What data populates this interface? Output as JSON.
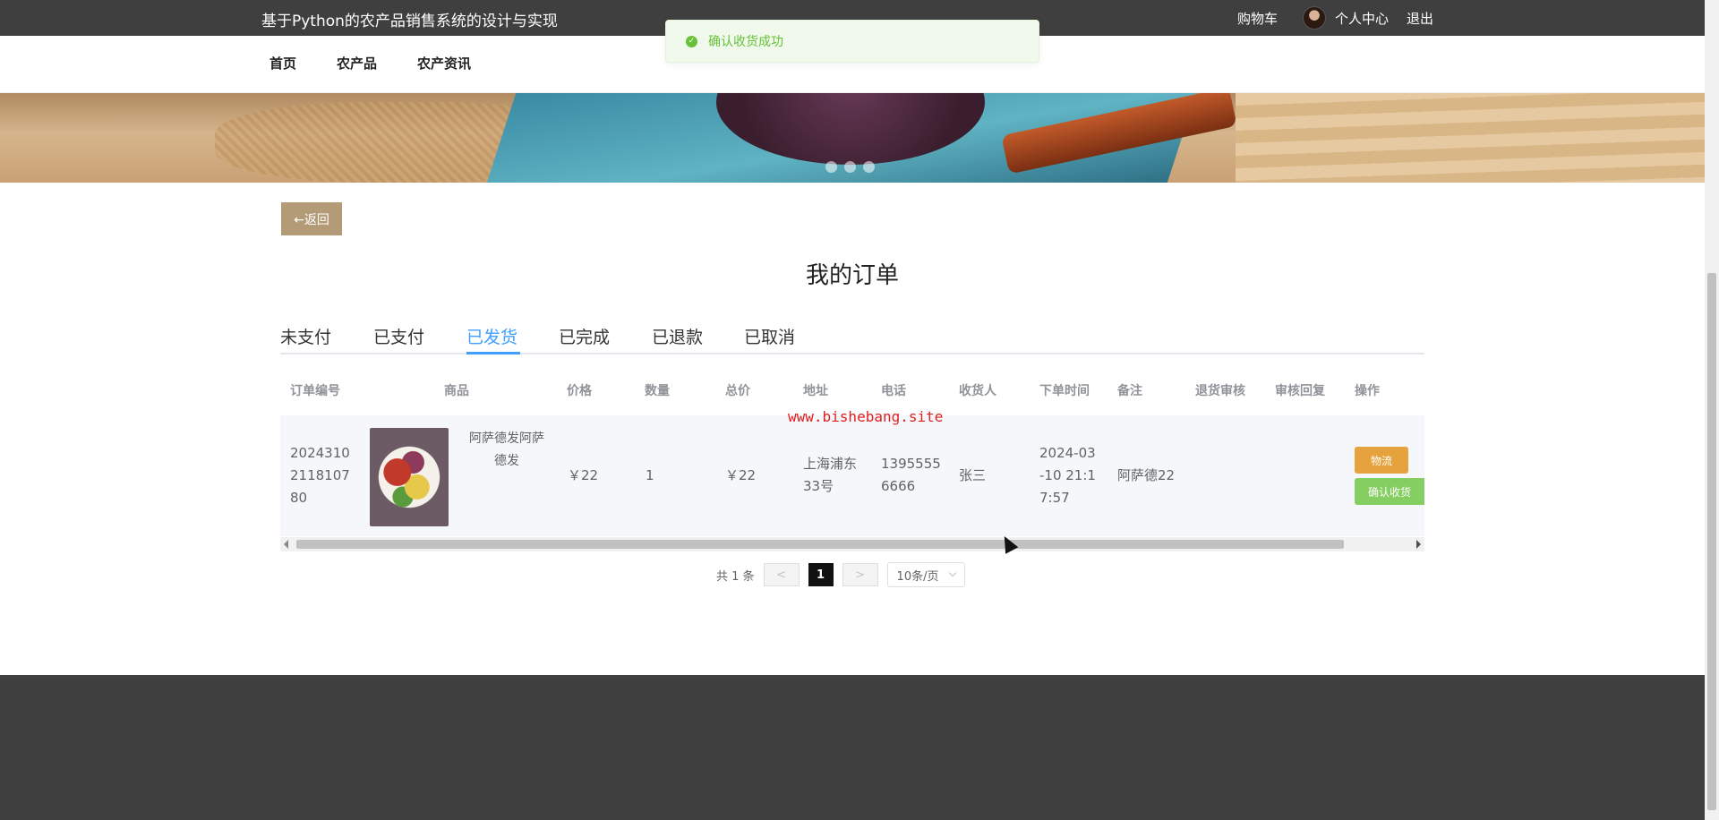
{
  "header": {
    "site_title": "基于Python的农产品销售系统的设计与实现",
    "cart": "购物车",
    "profile": "个人中心",
    "logout": "退出"
  },
  "nav": {
    "items": [
      "首页",
      "农产品",
      "农产资讯"
    ]
  },
  "toast": {
    "message": "确认收货成功",
    "color": "#67c23a"
  },
  "content": {
    "back_label": "←返回",
    "title": "我的订单",
    "tabs": [
      "未支付",
      "已支付",
      "已发货",
      "已完成",
      "已退款",
      "已取消"
    ],
    "active_tab": "已发货"
  },
  "table": {
    "columns": [
      "订单编号",
      "商品",
      "价格",
      "数量",
      "总价",
      "地址",
      "电话",
      "收货人",
      "下单时间",
      "备注",
      "退货审核",
      "审核回复",
      "操作"
    ],
    "rows": [
      {
        "order_no": "2024310 2118107 80",
        "order_no_lines": [
          "2024310",
          "2118107",
          "80"
        ],
        "product_name_lines": [
          "阿萨德发阿萨",
          "德发"
        ],
        "price": "￥22",
        "quantity": "1",
        "total": "￥22",
        "address_lines": [
          "上海浦东",
          "33号"
        ],
        "phone_lines": [
          "1395555",
          "6666"
        ],
        "receiver": "张三",
        "time_lines": [
          "2024-03",
          "-10 21:1",
          "7:57"
        ],
        "remark": "阿萨德22",
        "return_review": "",
        "review_reply": "",
        "actions": {
          "logistics": "物流",
          "confirm": "确认收货"
        }
      }
    ]
  },
  "watermark": "www.bishebang.site",
  "pagination": {
    "total_text": "共 1 条",
    "prev": "<",
    "current_page": "1",
    "next": ">",
    "page_size": "10条/页"
  },
  "colors": {
    "accent": "#409eff",
    "back_button": "#b49b78",
    "logistics_button": "#e6a23c",
    "confirm_button": "#85ce61",
    "topbar": "#3f3f3f",
    "footer": "#404040"
  }
}
